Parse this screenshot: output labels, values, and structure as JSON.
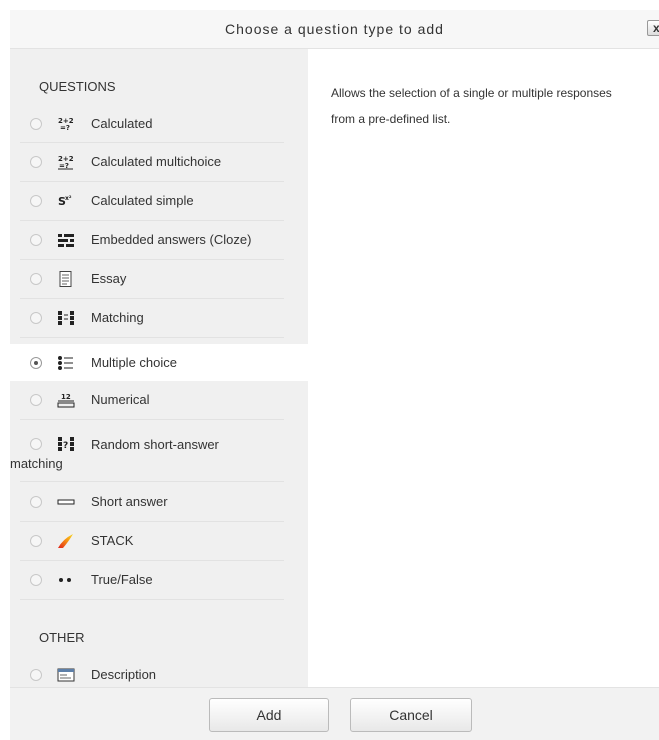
{
  "dialog": {
    "title": "Choose a question type to add",
    "close_label": "x"
  },
  "sections": {
    "questions_label": "QUESTIONS",
    "other_label": "OTHER"
  },
  "questions": [
    {
      "label": "Calculated",
      "icon": "calculated-icon",
      "selected": false
    },
    {
      "label": "Calculated multichoice",
      "icon": "calculated-multichoice-icon",
      "selected": false
    },
    {
      "label": "Calculated simple",
      "icon": "calculated-simple-icon",
      "selected": false
    },
    {
      "label": "Embedded answers (Cloze)",
      "icon": "cloze-icon",
      "selected": false
    },
    {
      "label": "Essay",
      "icon": "essay-icon",
      "selected": false
    },
    {
      "label": "Matching",
      "icon": "matching-icon",
      "selected": false
    },
    {
      "label": "Multiple choice",
      "icon": "multiple-choice-icon",
      "selected": true
    },
    {
      "label": "Numerical",
      "icon": "numerical-icon",
      "selected": false
    },
    {
      "label": "Random short-answer",
      "label_line2": "matching",
      "icon": "random-short-answer-icon",
      "selected": false
    },
    {
      "label": "Short answer",
      "icon": "short-answer-icon",
      "selected": false
    },
    {
      "label": "STACK",
      "icon": "stack-icon",
      "selected": false
    },
    {
      "label": "True/False",
      "icon": "true-false-icon",
      "selected": false
    }
  ],
  "other": [
    {
      "label": "Description",
      "icon": "description-icon",
      "selected": false
    }
  ],
  "description": "Allows the selection of a single or multiple responses from a pre-defined list.",
  "footer": {
    "add_label": "Add",
    "cancel_label": "Cancel"
  }
}
